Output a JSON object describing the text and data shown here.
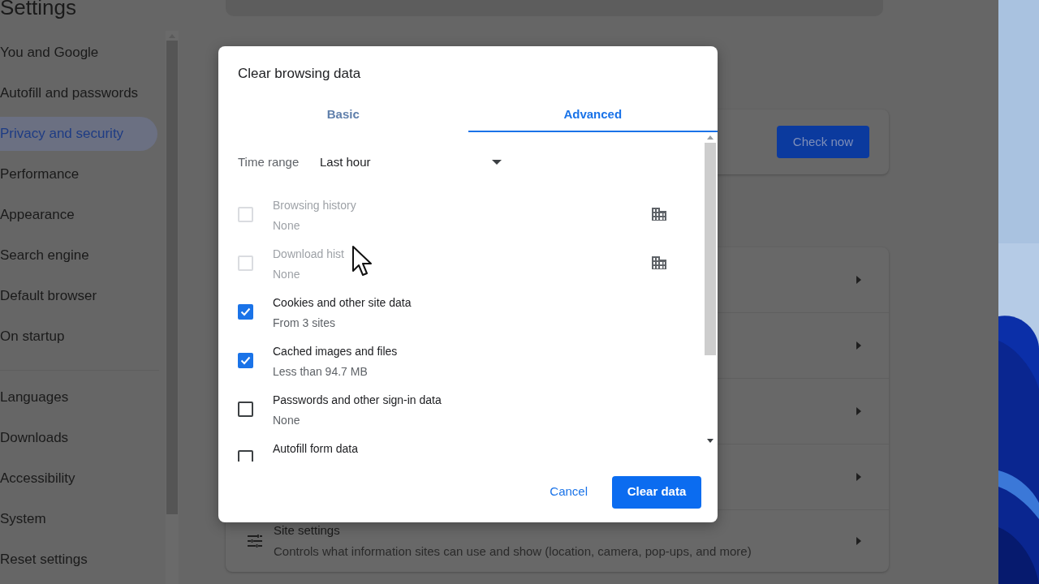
{
  "sidebar": {
    "title": "Settings",
    "items": [
      {
        "label": "You and Google",
        "selected": false
      },
      {
        "label": "Autofill and passwords",
        "selected": false
      },
      {
        "label": "Privacy and security",
        "selected": true
      },
      {
        "label": "Performance",
        "selected": false
      },
      {
        "label": "Appearance",
        "selected": false
      },
      {
        "label": "Search engine",
        "selected": false
      },
      {
        "label": "Default browser",
        "selected": false
      },
      {
        "label": "On startup",
        "selected": false
      },
      {
        "label": "Languages",
        "selected": false
      },
      {
        "label": "Downloads",
        "selected": false
      },
      {
        "label": "Accessibility",
        "selected": false
      },
      {
        "label": "System",
        "selected": false
      },
      {
        "label": "Reset settings",
        "selected": false
      }
    ]
  },
  "main": {
    "safety_check": {
      "button": "Check now"
    },
    "site_settings": {
      "title": "Site settings",
      "description": "Controls what information sites can use and show (location, camera, pop-ups, and more)"
    }
  },
  "dialog": {
    "title": "Clear browsing data",
    "tabs": [
      {
        "label": "Basic",
        "selected": false
      },
      {
        "label": "Advanced",
        "selected": true
      }
    ],
    "time_range": {
      "label": "Time range",
      "value": "Last hour"
    },
    "items": [
      {
        "label": "Browsing history",
        "detail": "None",
        "checked": false,
        "disabled": true,
        "managed": true
      },
      {
        "label": "Download hist",
        "detail": "None",
        "checked": false,
        "disabled": true,
        "managed": true
      },
      {
        "label": "Cookies and other site data",
        "detail": "From 3 sites",
        "checked": true,
        "disabled": false,
        "managed": false
      },
      {
        "label": "Cached images and files",
        "detail": "Less than 94.7 MB",
        "checked": true,
        "disabled": false,
        "managed": false
      },
      {
        "label": "Passwords and other sign-in data",
        "detail": "None",
        "checked": false,
        "disabled": false,
        "managed": false
      },
      {
        "label": "Autofill form data",
        "checked": false,
        "disabled": false,
        "managed": false
      }
    ],
    "buttons": [
      {
        "label": "Cancel",
        "kind": "text"
      },
      {
        "label": "Clear data",
        "kind": "filled"
      }
    ]
  }
}
